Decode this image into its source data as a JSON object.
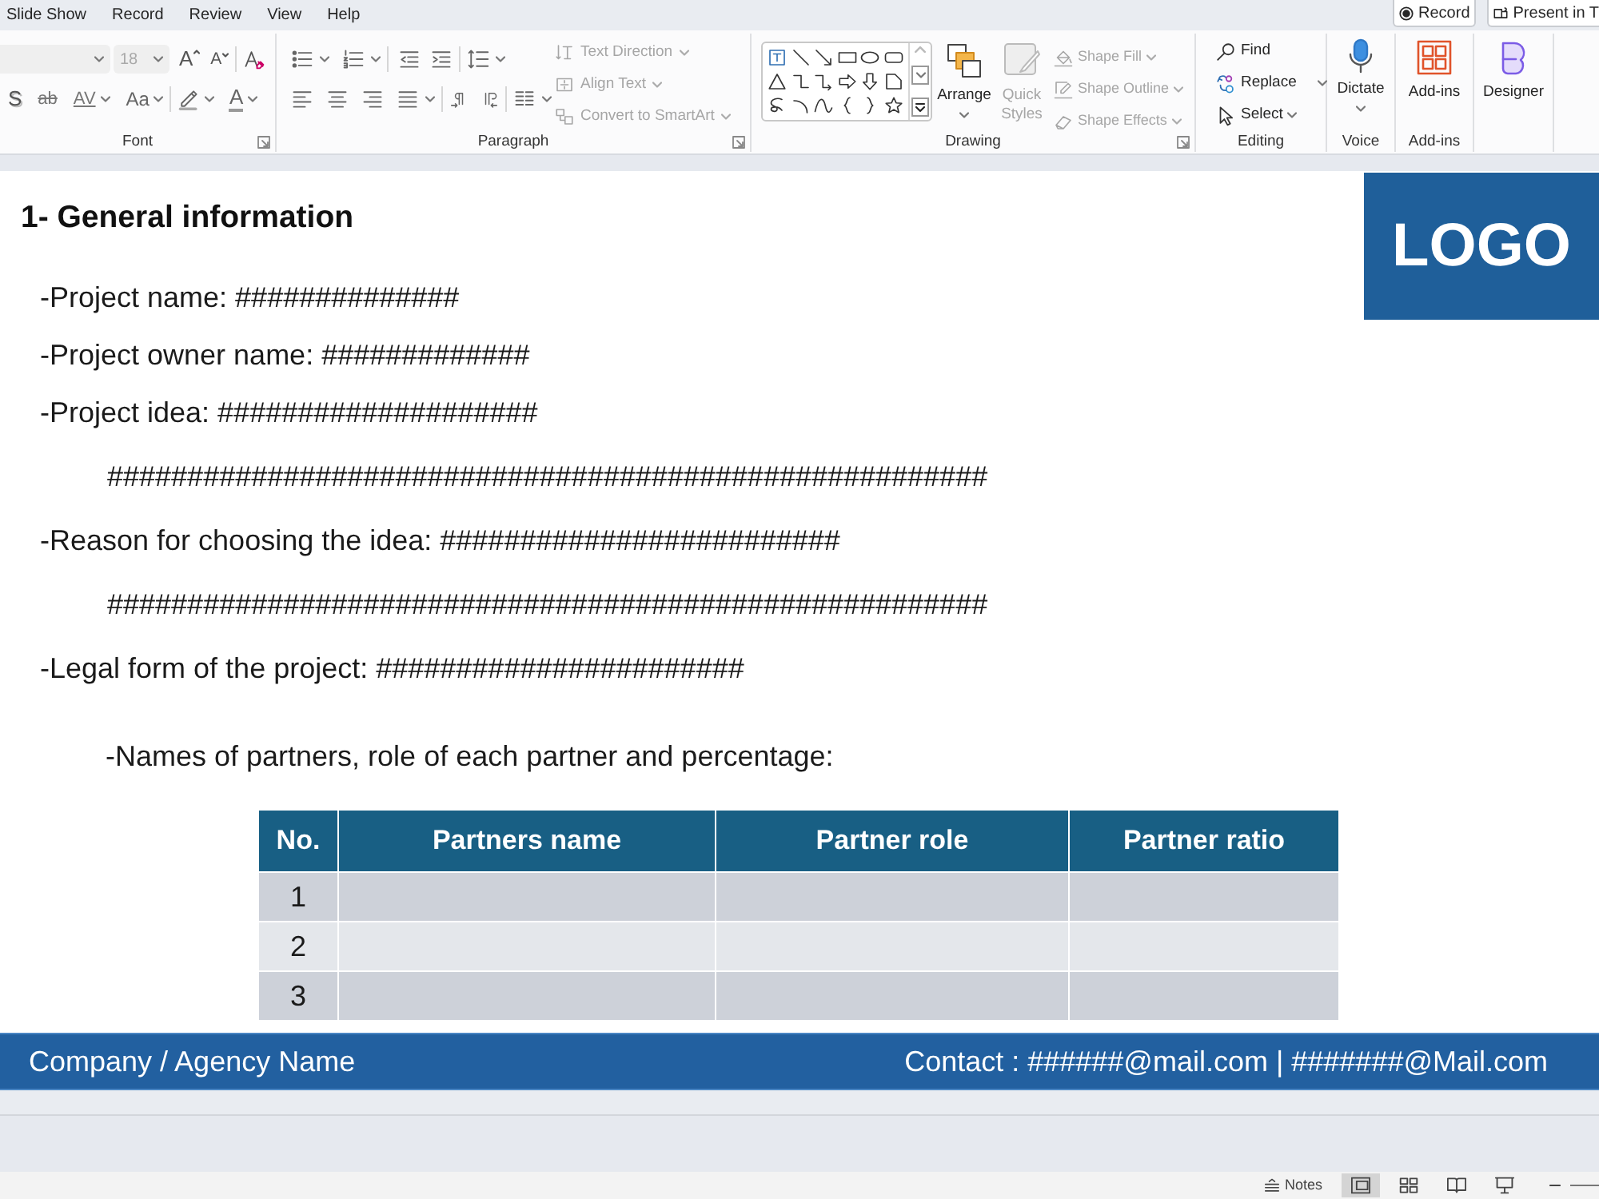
{
  "menu_tabs": [
    "Slide Show",
    "Record",
    "Review",
    "View",
    "Help"
  ],
  "title_buttons": [
    {
      "label": "Record"
    },
    {
      "label": "Present in T"
    }
  ],
  "ribbon": {
    "font": {
      "label": "Font",
      "launcher": true,
      "disabled": true,
      "size": "18",
      "grow": "A",
      "shrink": "A",
      "shadow": "S",
      "strikethrough": "ab",
      "spacing": "AV",
      "change_case": "Aa",
      "font_color": "A"
    },
    "paragraph": {
      "label": "Paragraph",
      "launcher": true,
      "commands": [
        {
          "label": "Text Direction",
          "disabled": true
        },
        {
          "label": "Align Text",
          "disabled": true
        },
        {
          "label": "Convert to SmartArt",
          "disabled": true
        }
      ]
    },
    "drawing": {
      "label": "Drawing",
      "launcher": true,
      "arrange": "Arrange",
      "quick_styles": {
        "label": "Quick Styles",
        "disabled": true
      },
      "commands": [
        {
          "label": "Shape Fill",
          "disabled": true
        },
        {
          "label": "Shape Outline",
          "disabled": true
        },
        {
          "label": "Shape Effects",
          "disabled": true
        }
      ]
    },
    "editing": {
      "label": "Editing",
      "commands": [
        {
          "label": "Find"
        },
        {
          "label": "Replace"
        },
        {
          "label": "Select"
        }
      ]
    },
    "voice": {
      "label": "Voice",
      "button": "Dictate"
    },
    "add_ins": {
      "label": "Add-ins",
      "button": "Add-ins"
    },
    "designer": {
      "button": "Designer"
    }
  },
  "slide": {
    "heading": "1- General information",
    "logo": "LOGO",
    "lines": [
      {
        "kind": "field",
        "text": "-Project name: ##############"
      },
      {
        "kind": "field",
        "text": "-Project owner name: #############"
      },
      {
        "kind": "field",
        "text": "-Project idea: ####################"
      },
      {
        "kind": "continuation",
        "text": "#######################################################"
      },
      {
        "kind": "field",
        "text": "-Reason for choosing the idea: #########################"
      },
      {
        "kind": "continuation",
        "text": "#######################################################"
      },
      {
        "kind": "field",
        "text": "-Legal form of the project: #######################"
      }
    ],
    "partners_intro": "-Names of partners, role of each partner and percentage:",
    "table": {
      "columns": [
        "No.",
        "Partners name",
        "Partner role",
        "Partner ratio"
      ],
      "rows": [
        {
          "no": "1"
        },
        {
          "no": "2"
        },
        {
          "no": "3"
        }
      ]
    },
    "footer": {
      "company": "Company / Agency Name",
      "contact": "Contact : ######@mail.com | #######@Mail.com"
    }
  },
  "status_bar": {
    "notes": "Notes",
    "views": [
      {
        "selected": true
      },
      {
        "selected": false
      },
      {
        "selected": false
      },
      {
        "selected": false
      }
    ]
  }
}
